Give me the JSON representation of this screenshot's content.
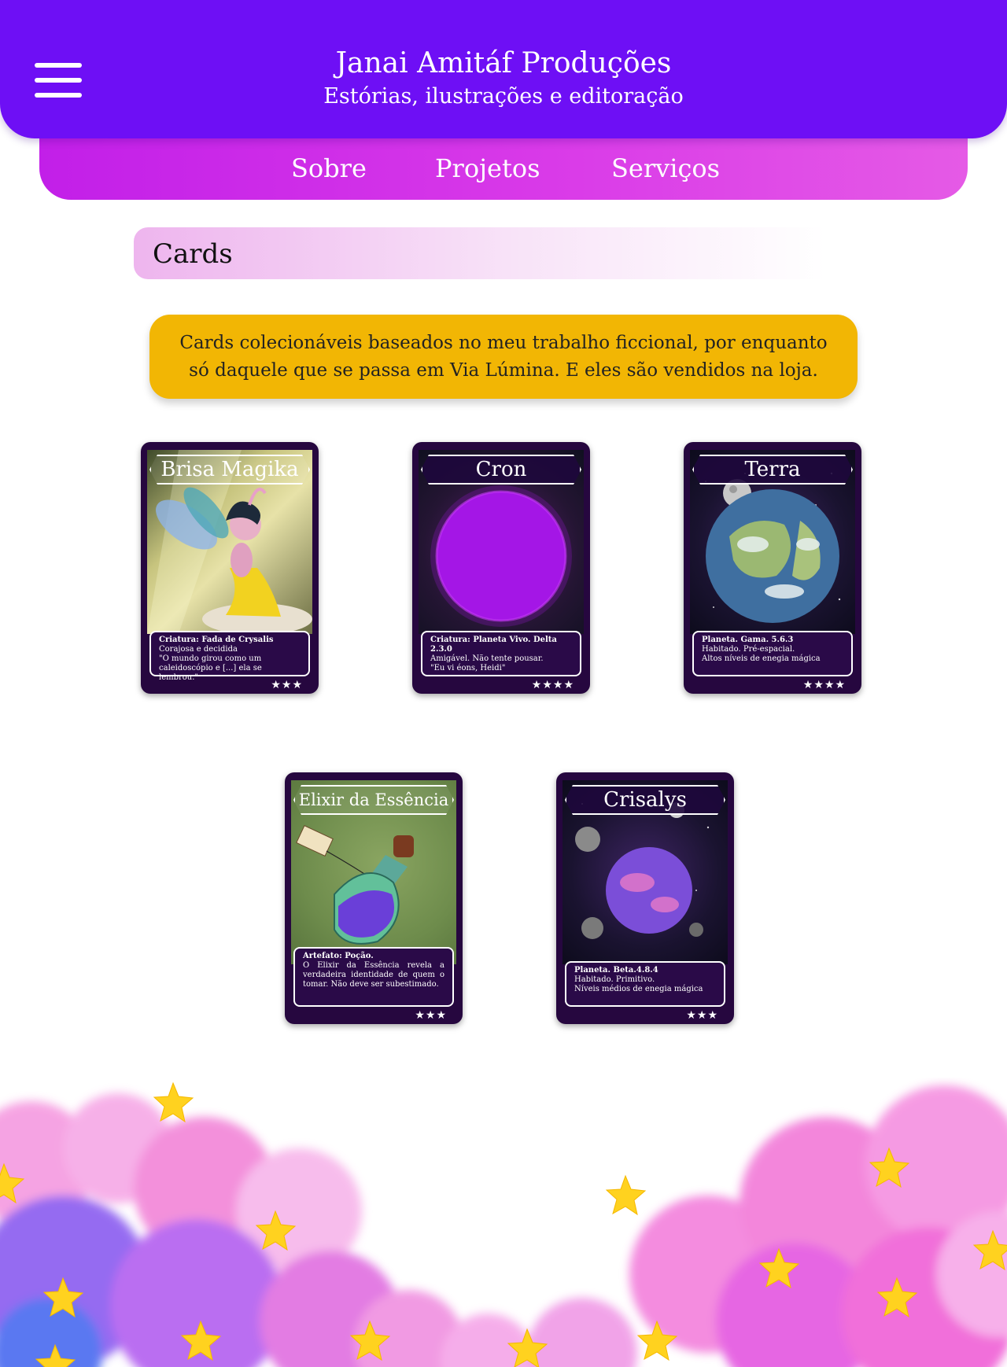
{
  "header": {
    "title": "Janai Amitáf Produções",
    "subtitle": "Estórias, ilustrações e editoração",
    "menu_icon": "hamburger-menu-icon"
  },
  "nav": {
    "items": [
      {
        "label": "Sobre"
      },
      {
        "label": "Projetos"
      },
      {
        "label": "Serviços"
      }
    ]
  },
  "section": {
    "title": "Cards"
  },
  "intro": {
    "text": "Cards colecionáveis baseados no meu trabalho ficcional, por enquanto só daquele que se passa em Via Lúmina. E eles são vendidos na loja."
  },
  "cards": [
    {
      "name": "Brisa Magika",
      "type": "Criatura: Fada de Crysalis",
      "lines": [
        "Corajosa e decidida",
        "\"O mundo girou como um caleidoscópio e [...] ela se lembrou.\""
      ],
      "stars": "★★★"
    },
    {
      "name": "Cron",
      "type": "Criatura: Planeta Vivo. Delta 2.3.0",
      "lines": [
        "Amigável. Não tente pousar.",
        "\"Eu vi éons, Heidi\""
      ],
      "stars": "★★★★"
    },
    {
      "name": "Terra",
      "type": "Planeta. Gama. 5.6.3",
      "lines": [
        "Habitado. Pré-espacial.",
        "Altos níveis de enegia mágica"
      ],
      "stars": "★★★★"
    },
    {
      "name": "Elixir da Essência",
      "type": "Artefato: Poção.",
      "lines": [
        "O Elixir da Essência revela a verdadeira identidade de quem o tomar. Não deve ser subestimado."
      ],
      "stars": "★★★"
    },
    {
      "name": "Crisalys",
      "type": "Planeta. Beta.4.8.4",
      "lines": [
        "Habitado. Primitivo.",
        "Níveis médios de enegia mágica"
      ],
      "stars": "★★★"
    }
  ],
  "colors": {
    "header": "#6e0ff5",
    "nav": "#d93ae8",
    "intro_box": "#f2b604",
    "card_bg": "#26073f"
  }
}
